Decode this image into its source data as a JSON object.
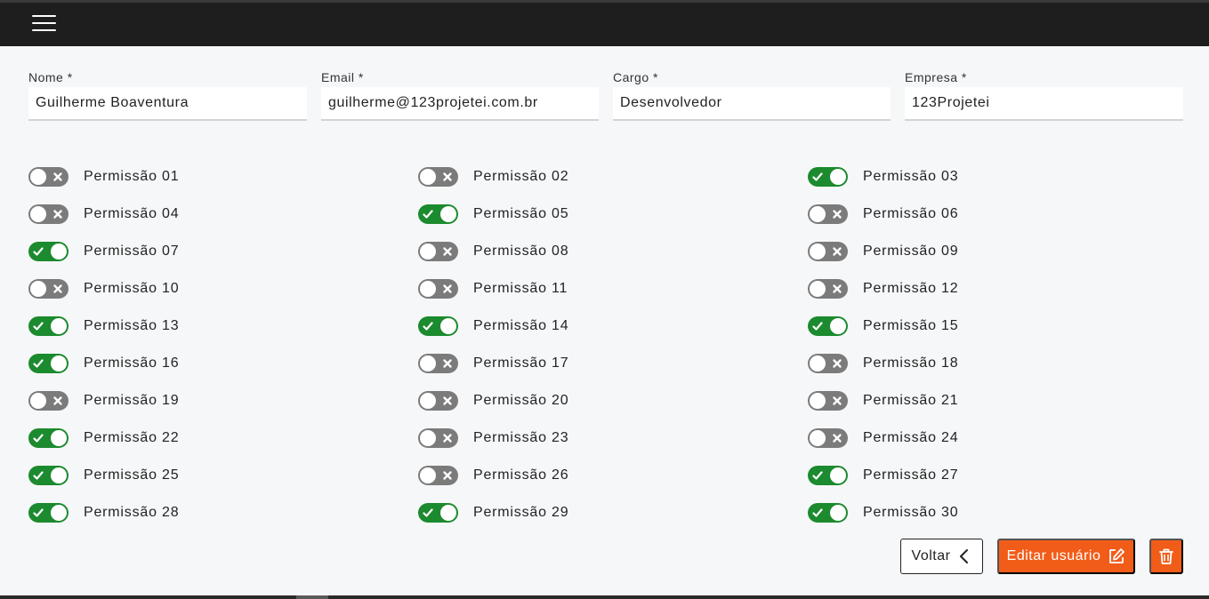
{
  "topbar": {
    "menu_icon": "hamburger-menu-icon"
  },
  "form": {
    "fields": [
      {
        "label": "Nome *",
        "value": "Guilherme Boaventura"
      },
      {
        "label": "Email *",
        "value": "guilherme@123projetei.com.br"
      },
      {
        "label": "Cargo *",
        "value": "Desenvolvedor"
      },
      {
        "label": "Empresa *",
        "value": "123Projetei"
      }
    ]
  },
  "permissions": [
    {
      "label": "Permissão 01",
      "enabled": false
    },
    {
      "label": "Permissão 02",
      "enabled": false
    },
    {
      "label": "Permissão 03",
      "enabled": true
    },
    {
      "label": "Permissão 04",
      "enabled": false
    },
    {
      "label": "Permissão 05",
      "enabled": true
    },
    {
      "label": "Permissão 06",
      "enabled": false
    },
    {
      "label": "Permissão 07",
      "enabled": true
    },
    {
      "label": "Permissão 08",
      "enabled": false
    },
    {
      "label": "Permissão 09",
      "enabled": false
    },
    {
      "label": "Permissão 10",
      "enabled": false
    },
    {
      "label": "Permissão 11",
      "enabled": false
    },
    {
      "label": "Permissão 12",
      "enabled": false
    },
    {
      "label": "Permissão 13",
      "enabled": true
    },
    {
      "label": "Permissão 14",
      "enabled": true
    },
    {
      "label": "Permissão 15",
      "enabled": true
    },
    {
      "label": "Permissão 16",
      "enabled": true
    },
    {
      "label": "Permissão 17",
      "enabled": false
    },
    {
      "label": "Permissão 18",
      "enabled": false
    },
    {
      "label": "Permissão 19",
      "enabled": false
    },
    {
      "label": "Permissão 20",
      "enabled": false
    },
    {
      "label": "Permissão 21",
      "enabled": false
    },
    {
      "label": "Permissão 22",
      "enabled": true
    },
    {
      "label": "Permissão 23",
      "enabled": false
    },
    {
      "label": "Permissão 24",
      "enabled": false
    },
    {
      "label": "Permissão 25",
      "enabled": true
    },
    {
      "label": "Permissão 26",
      "enabled": false
    },
    {
      "label": "Permissão 27",
      "enabled": true
    },
    {
      "label": "Permissão 28",
      "enabled": true
    },
    {
      "label": "Permissão 29",
      "enabled": true
    },
    {
      "label": "Permissão 30",
      "enabled": true
    }
  ],
  "actions": {
    "back_label": "Voltar",
    "back_icon": "chevron-left-icon",
    "edit_label": "Editar usuário",
    "edit_icon": "edit-icon",
    "delete_icon": "trash-icon"
  },
  "colors": {
    "topbar": "#1e1e1e",
    "toggle_on": "#1c8a2e",
    "toggle_off": "#7b7b7b",
    "accent": "#f25c19"
  }
}
